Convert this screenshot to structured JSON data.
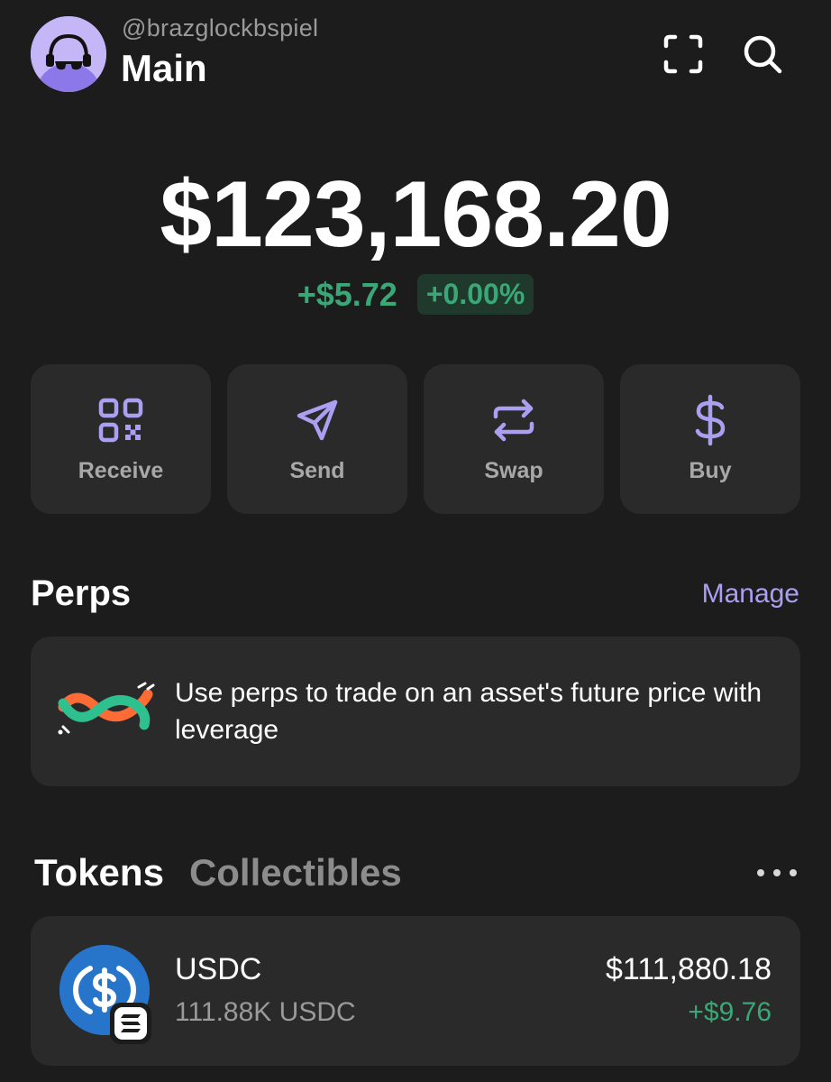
{
  "account": {
    "handle": "@brazglockbspiel",
    "name": "Main"
  },
  "header": {
    "scan_icon": "scan-icon",
    "search_icon": "search-icon"
  },
  "balance": {
    "total": "$123,168.20",
    "change_amount": "+$5.72",
    "change_percent": "+0.00%"
  },
  "actions": [
    {
      "label": "Receive",
      "icon": "qr-code-icon"
    },
    {
      "label": "Send",
      "icon": "send-icon"
    },
    {
      "label": "Swap",
      "icon": "swap-icon"
    },
    {
      "label": "Buy",
      "icon": "dollar-icon"
    }
  ],
  "perps": {
    "title": "Perps",
    "manage_label": "Manage",
    "description": "Use perps to trade on an asset's future price with leverage"
  },
  "tabs": {
    "tokens": "Tokens",
    "collectibles": "Collectibles"
  },
  "tokens": [
    {
      "name": "USDC",
      "amount": "111.88K USDC",
      "value": "$111,880.18",
      "change": "+$9.76"
    }
  ],
  "colors": {
    "background": "#1c1c1c",
    "card": "#2a2a2a",
    "accent": "#ab9ff2",
    "positive": "#3aa876",
    "usdc_blue": "#2775ca"
  }
}
